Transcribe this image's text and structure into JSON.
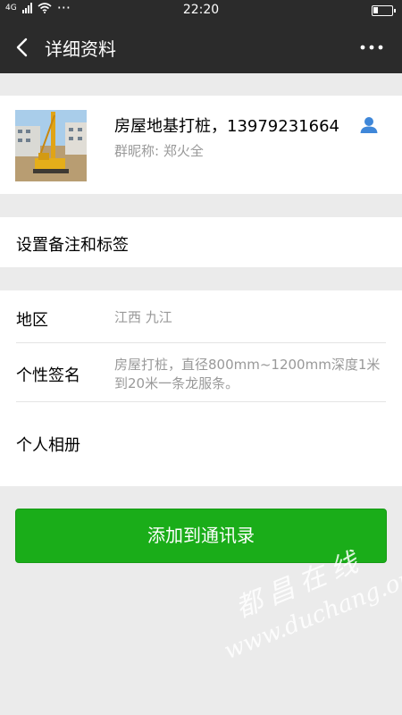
{
  "status_bar": {
    "network": "4G",
    "dots": "···",
    "time": "22:20"
  },
  "nav": {
    "title": "详细资料",
    "back_icon": "chevron-left-icon",
    "more_label": "···"
  },
  "profile": {
    "name": "房屋地基打桩，13979231664",
    "nickname": "群昵称: 郑火全",
    "avatar": "construction-pile-driver-photo",
    "contact_icon": "person-icon"
  },
  "remark": {
    "label": "设置备注和标签"
  },
  "info": {
    "region_label": "地区",
    "region_value": "江西  九江",
    "signature_label": "个性签名",
    "signature_value": "房屋打桩，直径800mm~1200mm深度1米到20米一条龙服条。",
    "album_label": "个人相册"
  },
  "actions": {
    "add_button": "添加到通讯录"
  },
  "watermark": {
    "line1": "都昌在线",
    "line2": "www.duchang.org"
  },
  "colors": {
    "header_bg": "#2b2b2b",
    "page_bg": "#ebebeb",
    "button_green": "#1aad19",
    "contact_icon_blue": "#3f87d9"
  }
}
